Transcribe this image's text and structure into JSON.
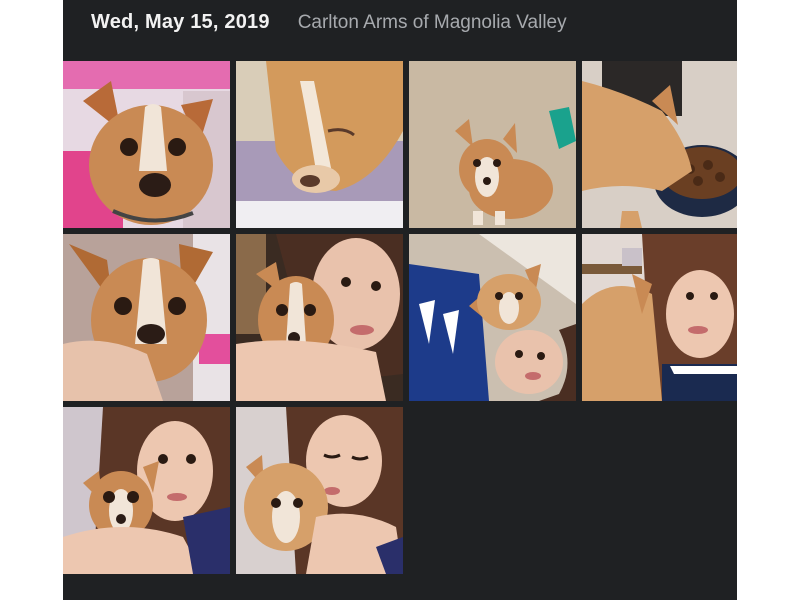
{
  "header": {
    "date": "Wed, May 15, 2019",
    "location": "Carlton Arms of Magnolia Valley"
  },
  "photos": [
    {
      "subject": "chihuahua close-up on pink blanket"
    },
    {
      "subject": "chihuahua sleeping on towel"
    },
    {
      "subject": "chihuahua sitting on carpet"
    },
    {
      "subject": "chihuahua eating from bowl"
    },
    {
      "subject": "chihuahua held close"
    },
    {
      "subject": "girl hugging chihuahua"
    },
    {
      "subject": "girl lying on floor with chihuahua"
    },
    {
      "subject": "girl kissing chihuahua"
    },
    {
      "subject": "girl holding chihuahua"
    },
    {
      "subject": "girl kissing chihuahua with eyes closed"
    }
  ],
  "colors": {
    "background": "#1f2123",
    "date_text": "#f2f2f2",
    "location_text": "#a7aaae",
    "dog_fur": "#c8894f",
    "hair": "#5a3a2a"
  }
}
